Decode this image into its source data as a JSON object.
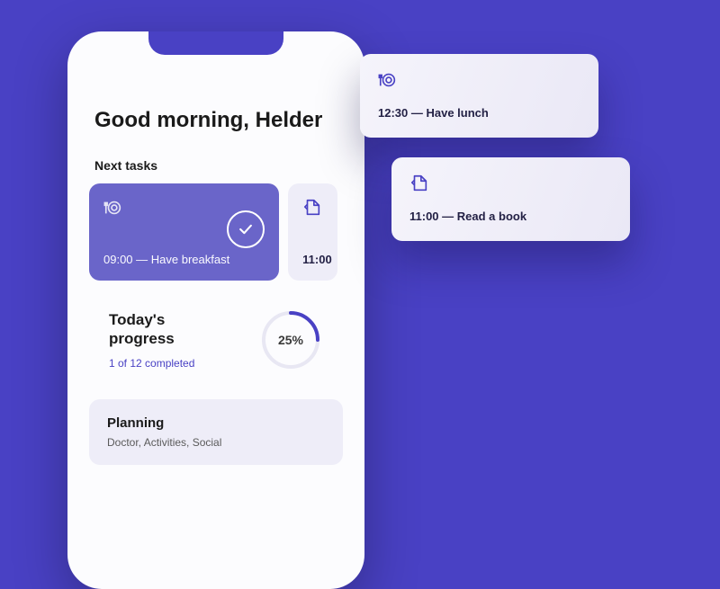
{
  "greeting": "Good morning, Helder",
  "next_tasks_label": "Next tasks",
  "tasks": {
    "primary": {
      "time": "09:00",
      "label": "Have breakfast",
      "text": "09:00 — Have breakfast",
      "completed": true
    },
    "secondary": {
      "time": "11:00",
      "text": "11:00"
    }
  },
  "progress": {
    "title": "Today's progress",
    "completed": 1,
    "total": 12,
    "sub": "1 of 12 completed",
    "percent": 25,
    "percent_label": "25%"
  },
  "planning": {
    "title": "Planning",
    "sub": "Doctor, Activities, Social"
  },
  "floating": [
    {
      "icon": "plate",
      "time": "12:30",
      "label": "Have lunch",
      "text": "12:30 — Have lunch"
    },
    {
      "icon": "book",
      "time": "11:00",
      "label": "Read a book",
      "text": "11:00 — Read a book"
    }
  ]
}
